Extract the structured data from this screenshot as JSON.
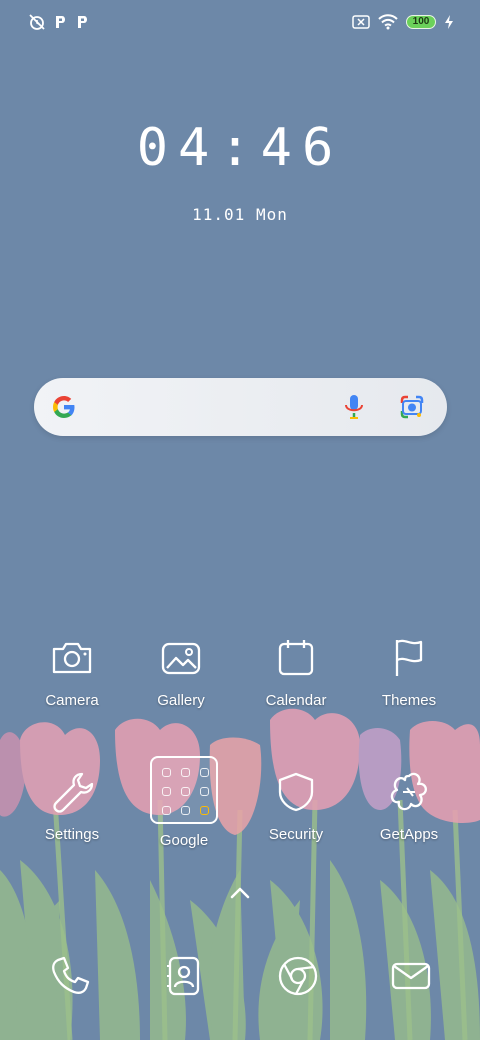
{
  "status_bar": {
    "left_icons": [
      "alarm-off-icon",
      "p-notification-icon",
      "p-notification-icon"
    ],
    "right_icons": [
      "sim-off-icon",
      "wifi-icon",
      "battery-icon",
      "charging-icon"
    ],
    "battery": "100"
  },
  "clock": {
    "time": "04:46",
    "date": "11.01 Mon"
  },
  "search_bar": {
    "icons": [
      "google-logo",
      "mic-icon",
      "lens-icon"
    ]
  },
  "apps": [
    {
      "label": "Camera",
      "icon": "camera-icon"
    },
    {
      "label": "Gallery",
      "icon": "gallery-icon"
    },
    {
      "label": "Calendar",
      "icon": "calendar-icon"
    },
    {
      "label": "Themes",
      "icon": "flag-icon"
    },
    {
      "label": "Settings",
      "icon": "wrench-icon"
    },
    {
      "label": "Google",
      "icon": "folder-icon"
    },
    {
      "label": "Security",
      "icon": "shield-icon"
    },
    {
      "label": "GetApps",
      "icon": "flower-icon"
    }
  ],
  "dock": [
    "phone-icon",
    "contacts-icon",
    "browser-icon",
    "mail-icon"
  ],
  "colors": {
    "background": "#6d88a8",
    "tulip_pink": "#e7a0b4",
    "stem_green": "#8fb37e",
    "battery_green": "#6bd15a"
  }
}
